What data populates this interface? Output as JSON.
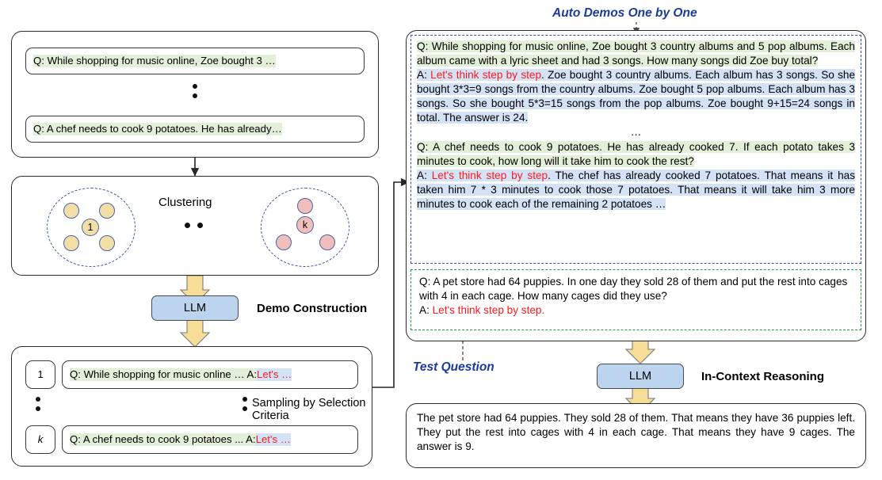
{
  "left": {
    "questions_box": {
      "items": [
        "Q: While shopping for music online, Zoe bought 3 …",
        "Q: A chef needs to cook 9 potatoes. He has already…"
      ]
    },
    "clustering": {
      "label": "Clustering",
      "cluster1_label": "1",
      "clusterk_label": "k"
    },
    "llm_label": "LLM",
    "demo_construction_label": "Demo Construction",
    "sampling": {
      "label": "Sampling by Selection Criteria",
      "rows": [
        {
          "index": "1",
          "q": "Q: While shopping for music online … A: ",
          "a": "Let's …"
        },
        {
          "index": "k",
          "q": "Q: A chef needs to cook 9 potatoes ... A: ",
          "a": "Let's …"
        }
      ]
    }
  },
  "right": {
    "auto_demos_title": "Auto Demos One by One",
    "test_question_title": "Test Question",
    "llm_label": "LLM",
    "in_context_reasoning_label": "In-Context Reasoning",
    "demos": [
      {
        "q_prefix": "Q: ",
        "q": "While shopping for music online, Zoe bought 3 country albums and 5 pop albums. Each album came with a lyric sheet and had 3 songs. How many songs did Zoe buy total?",
        "a_prefix": "A: ",
        "a_trigger": "Let's think step by step",
        "a_rest": ". Zoe bought 3 country albums. Each album has 3 songs. So she bought 3*3=9 songs from the country albums. Zoe bought 5 pop albums. Each album has 3 songs. So she bought 5*3=15 songs from the pop albums. Zoe bought 9+15=24 songs in total. The answer is 24."
      },
      {
        "q_prefix": "Q: ",
        "q": "A chef needs to cook 9 potatoes. He has already cooked 7. If each potato takes 3 minutes to cook, how long will it take him to cook the rest?",
        "a_prefix": "A: ",
        "a_trigger": "Let's think step by step",
        "a_rest": ". The chef has already cooked 7 potatoes. That means it has taken him 7 * 3 minutes to cook those 7 potatoes. That means it will take him 3 more minutes to cook each of the remaining 2 potatoes …"
      }
    ],
    "demo_separator": "…",
    "test_question": {
      "q_prefix": "Q: ",
      "q": "A pet store had 64 puppies. In one day they sold 28 of them and put the rest into cages with 4 in each cage. How many cages did they use?",
      "a_prefix": "A: ",
      "a_trigger": "Let's think step by step."
    },
    "output": "The pet store had 64 puppies. They sold 28 of them. That means they have 36 puppies left. They put the rest into cages with 4 in each cage. That means they have 9 cages. The answer is 9."
  },
  "colors": {
    "question_highlight": "#e2efd9",
    "answer_highlight": "#d4e2f5",
    "trigger_red": "#ff1a1a",
    "accent_blue": "#1b3a9e",
    "demos_border": "#2f4fbf",
    "test_border": "#1f9a4a",
    "llm_fill": "#bcd4ed",
    "arrow_fill": "#f7dd96",
    "cluster_yellow": "#f2dfa6",
    "cluster_pink": "#f0bfbc"
  }
}
